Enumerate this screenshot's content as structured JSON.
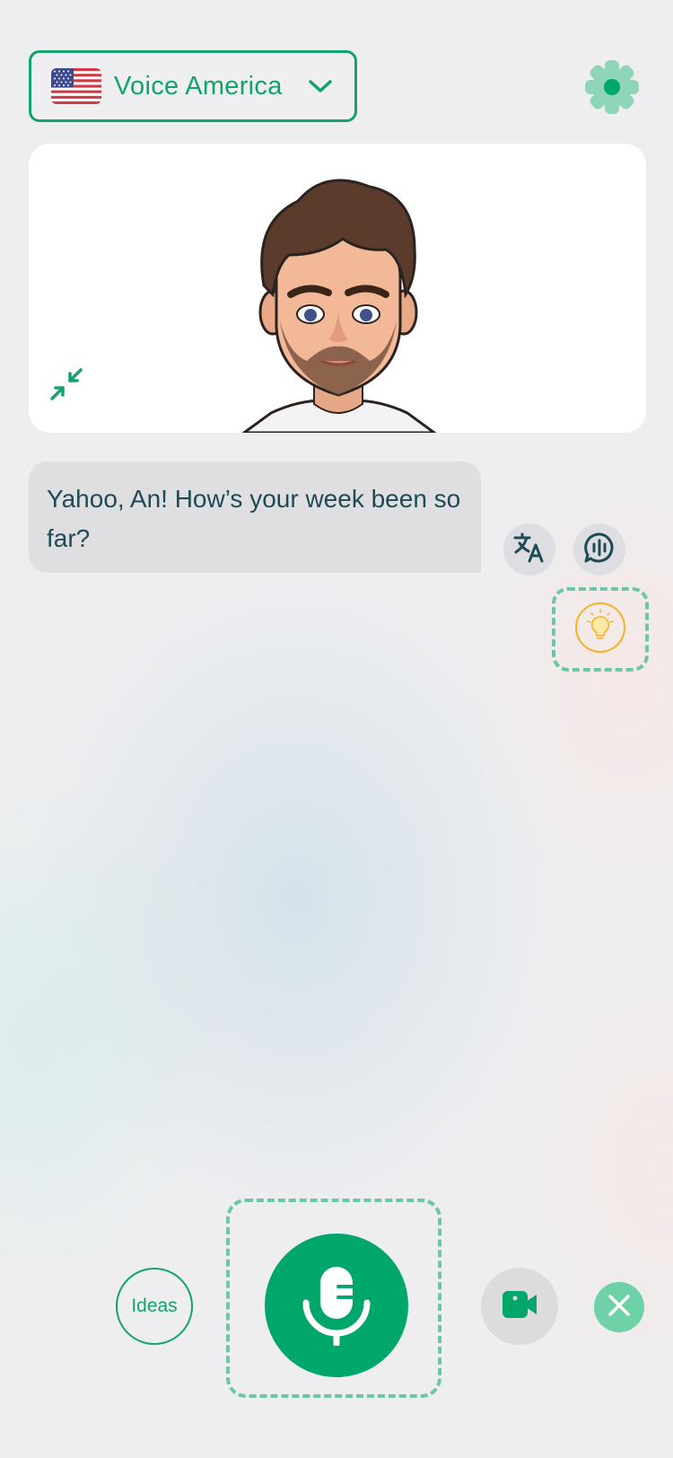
{
  "header": {
    "language": {
      "label": "Voice America",
      "flag_icon": "us-flag-icon",
      "dropdown_icon": "chevron-down-icon"
    },
    "settings_icon": "gear-icon"
  },
  "avatar_card": {
    "collapse_icon": "collapse-arrows-icon"
  },
  "conversation": {
    "messages": [
      {
        "text": "Yahoo, An! How’s your week been so far?"
      }
    ],
    "actions": {
      "translate_icon": "translate-icon",
      "audio_icon": "speech-bubble-audio-icon",
      "hint_icon": "lightbulb-icon"
    }
  },
  "controls": {
    "ideas_label": "Ideas",
    "mic_icon": "microphone-icon",
    "video_icon": "video-camera-icon",
    "close_icon": "close-icon"
  },
  "colors": {
    "accent": "#00a76a",
    "accent_light": "#6fd1a8",
    "bubble": "#dfdfe2",
    "text": "#1d4a55",
    "hint": "#f5b323"
  }
}
